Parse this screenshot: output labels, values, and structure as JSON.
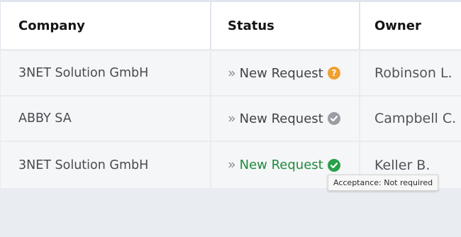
{
  "table": {
    "headers": {
      "company": "Company",
      "status": "Status",
      "owner": "Owner"
    },
    "rows": [
      {
        "company": "3NET Solution GmbH",
        "status": "New Request",
        "status_icon": "question-circle-icon",
        "status_icon_color": "#f0a030",
        "owner": "Robinson L."
      },
      {
        "company": "ABBY SA",
        "status": "New Request",
        "status_icon": "check-circle-icon",
        "status_icon_color": "#9a9ea4",
        "owner": "Campbell C."
      },
      {
        "company": "3NET Solution GmbH",
        "status": "New Request",
        "status_icon": "check-circle-icon",
        "status_icon_color": "#2aa04a",
        "owner": "Keller B."
      }
    ]
  },
  "tooltip": {
    "text": "Acceptance: Not required"
  },
  "colors": {
    "header_band": "#e1e5ee",
    "status_green": "#1f8a3e"
  }
}
